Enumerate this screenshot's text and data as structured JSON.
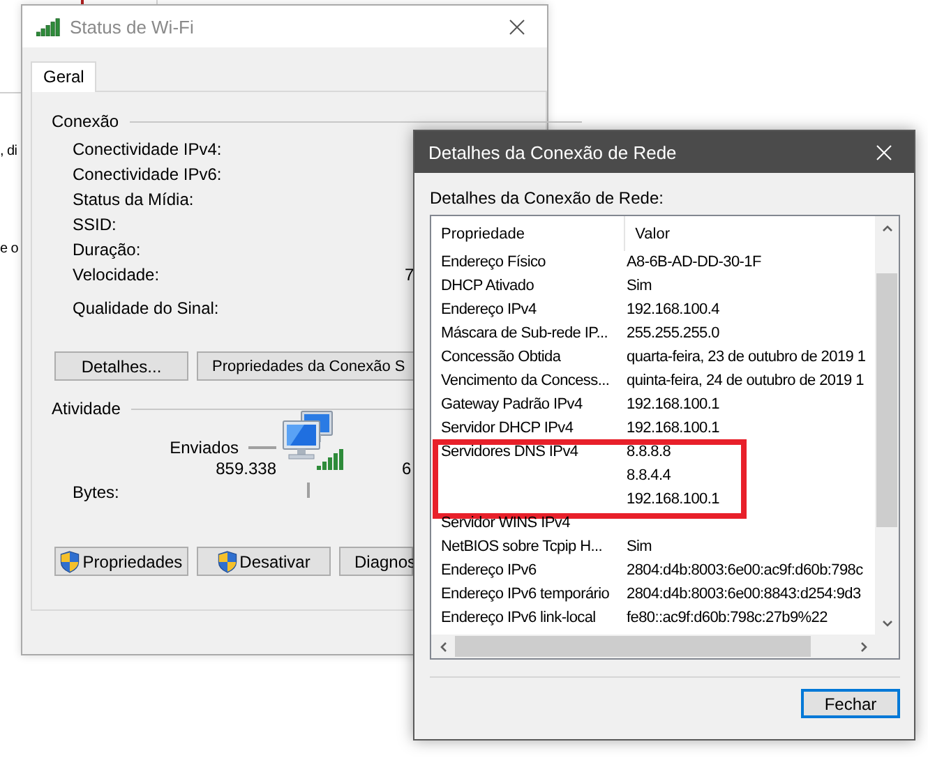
{
  "background": {
    "fragments": [
      ", di",
      "e o"
    ]
  },
  "status_window": {
    "title": "Status de Wi-Fi",
    "active": false,
    "tabs": [
      {
        "label": "Geral",
        "selected": true
      }
    ],
    "connection": {
      "heading": "Conexão",
      "fields": [
        {
          "label": "Conectividade IPv4:"
        },
        {
          "label": "Conectividade IPv6:"
        },
        {
          "label": "Status da Mídia:"
        },
        {
          "label": "SSID:"
        },
        {
          "label": "Duração:"
        },
        {
          "label": "Velocidade:",
          "value": "7"
        },
        {
          "label": "Qualidade do Sinal:"
        }
      ],
      "buttons": [
        "Detalhes...",
        "Propriedades da Conexão S"
      ]
    },
    "activity": {
      "heading": "Atividade",
      "sent_label": "Enviados",
      "bytes_label": "Bytes:",
      "sent_bytes": "859.338",
      "received_bytes": "6"
    },
    "buttons": [
      {
        "label": "Propriedades",
        "shield": true
      },
      {
        "label": "Desativar",
        "shield": true
      },
      {
        "label": "Diagnos",
        "shield": false
      }
    ]
  },
  "details_dialog": {
    "title": "Detalhes da Conexão de Rede",
    "active": true,
    "list_label": "Detalhes da Conexão de Rede:",
    "columns": [
      "Propriedade",
      "Valor"
    ],
    "rows": [
      {
        "property": "Endereço Físico",
        "values": [
          "A8-6B-AD-DD-30-1F"
        ],
        "highlighted": false
      },
      {
        "property": "DHCP Ativado",
        "values": [
          "Sim"
        ],
        "highlighted": false
      },
      {
        "property": "Endereço IPv4",
        "values": [
          "192.168.100.4"
        ],
        "highlighted": false
      },
      {
        "property": "Máscara de Sub-rede IP...",
        "values": [
          "255.255.255.0"
        ],
        "highlighted": false
      },
      {
        "property": "Concessão Obtida",
        "values": [
          "quarta-feira, 23 de outubro de 2019 1"
        ],
        "highlighted": false
      },
      {
        "property": "Vencimento da Concess...",
        "values": [
          "quinta-feira, 24 de outubro de 2019 1"
        ],
        "highlighted": false
      },
      {
        "property": "Gateway Padrão IPv4",
        "values": [
          "192.168.100.1"
        ],
        "highlighted": false
      },
      {
        "property": "Servidor DHCP IPv4",
        "values": [
          "192.168.100.1"
        ],
        "highlighted": false
      },
      {
        "property": "Servidores DNS IPv4",
        "values": [
          "8.8.8.8",
          "8.8.4.4",
          "192.168.100.1"
        ],
        "highlighted": true
      },
      {
        "property": "Servidor WINS IPv4",
        "values": [],
        "highlighted": false
      },
      {
        "property": "NetBIOS sobre Tcpip H...",
        "values": [
          "Sim"
        ],
        "highlighted": false
      },
      {
        "property": "Endereço IPv6",
        "values": [
          "2804:d4b:8003:6e00:ac9f:d60b:798c"
        ],
        "highlighted": false
      },
      {
        "property": "Endereço IPv6 temporário",
        "values": [
          "2804:d4b:8003:6e00:8843:d254:9d3"
        ],
        "highlighted": false
      },
      {
        "property": "Endereço IPv6 link-local",
        "values": [
          "fe80::ac9f:d60b:798c:27b9%22"
        ],
        "highlighted": false
      }
    ],
    "buttons": [
      {
        "label": "Fechar",
        "default": true
      }
    ]
  }
}
